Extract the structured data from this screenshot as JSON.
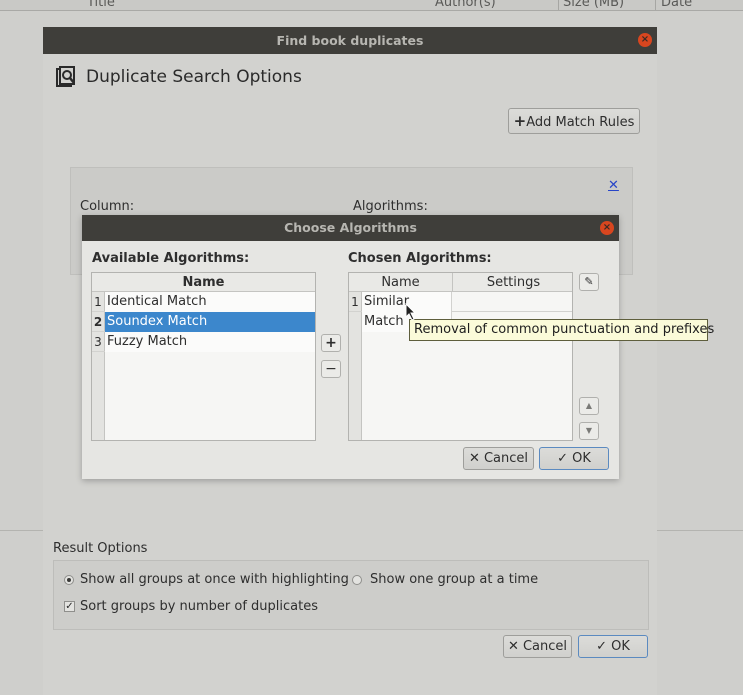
{
  "background": {
    "columns": [
      "Title",
      "Author(s)",
      "Size (MB)",
      "Date"
    ]
  },
  "dup_dialog": {
    "title": "Find book duplicates",
    "heading": "Duplicate Search Options",
    "add_match_rules": "Add Match Rules",
    "column_label": "Column:",
    "algorithms_label": "Algorithms:",
    "result_options_label": "Result Options",
    "radio_all": "Show all groups at once with highlighting",
    "radio_one": "Show one group at a time",
    "sort_groups": "Sort groups by number of duplicates",
    "cancel": "Cancel",
    "ok": "OK"
  },
  "algo_dialog": {
    "title": "Choose Algorithms",
    "available_label": "Available Algorithms:",
    "chosen_label": "Chosen Algorithms:",
    "available_header": "Name",
    "available_rows": [
      {
        "num": "1",
        "name": "Identical Match",
        "selected": false
      },
      {
        "num": "2",
        "name": "Soundex Match",
        "selected": true
      },
      {
        "num": "3",
        "name": "Fuzzy Match",
        "selected": false
      }
    ],
    "chosen_headers": {
      "name": "Name",
      "settings": "Settings"
    },
    "chosen_rows": [
      {
        "num": "1",
        "name": "Similar Match",
        "settings": ""
      }
    ],
    "cancel": "Cancel",
    "ok": "OK"
  },
  "tooltip": "Removal of common punctuation and prefixes",
  "icons": {
    "close": "close-icon",
    "add": "plus-icon",
    "remove": "minus-icon",
    "edit": "edit-icon",
    "up": "arrow-up-icon",
    "down": "arrow-down-icon",
    "search_doc": "search-document-icon"
  },
  "colors": {
    "titlebar": "#3f3e3a",
    "close": "#d8461f",
    "selection": "#3c87cc",
    "tooltip_bg": "#fbfbd9",
    "link": "#2845c8"
  }
}
